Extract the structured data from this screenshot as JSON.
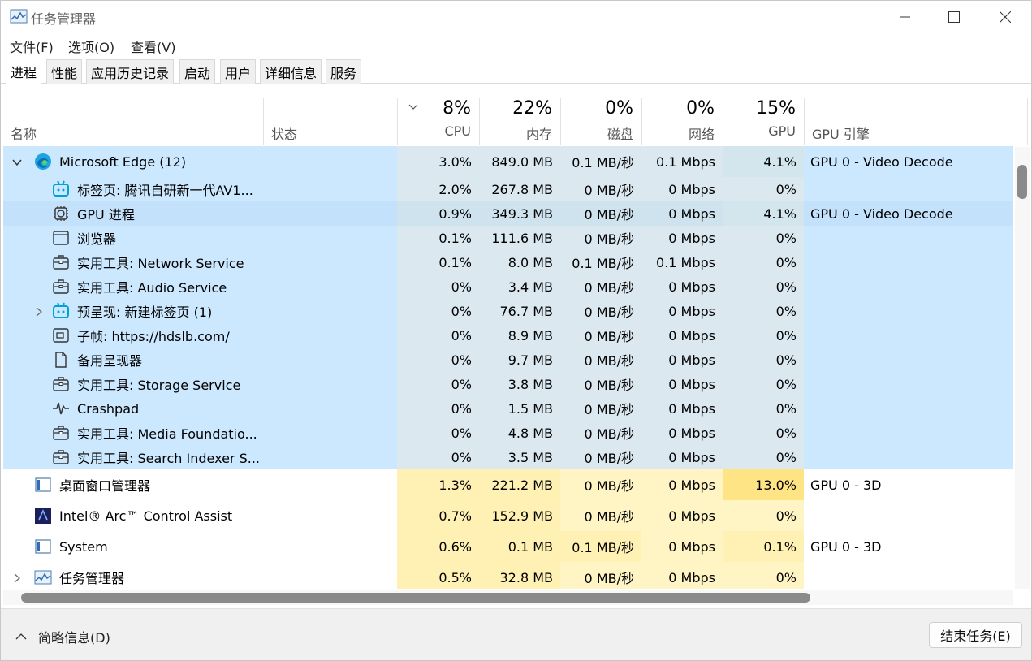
{
  "window": {
    "title": "任务管理器"
  },
  "menu": [
    "文件(F)",
    "选项(O)",
    "查看(V)"
  ],
  "tabs": [
    "进程",
    "性能",
    "应用历史记录",
    "启动",
    "用户",
    "详细信息",
    "服务"
  ],
  "columns": {
    "name": "名称",
    "status": "状态",
    "cpu": {
      "pct": "8%",
      "label": "CPU"
    },
    "mem": {
      "pct": "22%",
      "label": "内存"
    },
    "disk": {
      "pct": "0%",
      "label": "磁盘"
    },
    "net": {
      "pct": "0%",
      "label": "网络"
    },
    "gpu": {
      "pct": "15%",
      "label": "GPU"
    },
    "gpu_engine": "GPU 引擎"
  },
  "processes": [
    {
      "name": "Microsoft Edge (12)",
      "icon": "edge-icon",
      "cpu": "3.0%",
      "mem": "849.0 MB",
      "disk": "0.1 MB/秒",
      "net": "0.1 Mbps",
      "gpu": "4.1%",
      "engine": "GPU 0 - Video Decode"
    },
    {
      "name": "标签页: 腾讯自研新一代AV1...",
      "icon": "bilibili-icon",
      "cpu": "2.0%",
      "mem": "267.8 MB",
      "disk": "0 MB/秒",
      "net": "0 Mbps",
      "gpu": "0%",
      "engine": ""
    },
    {
      "name": "GPU 进程",
      "icon": "gpu-chip-icon",
      "cpu": "0.9%",
      "mem": "349.3 MB",
      "disk": "0 MB/秒",
      "net": "0 Mbps",
      "gpu": "4.1%",
      "engine": "GPU 0 - Video Decode"
    },
    {
      "name": "浏览器",
      "icon": "browser-window-icon",
      "cpu": "0.1%",
      "mem": "111.6 MB",
      "disk": "0 MB/秒",
      "net": "0 Mbps",
      "gpu": "0%",
      "engine": ""
    },
    {
      "name": "实用工具: Network Service",
      "icon": "toolbox-icon",
      "cpu": "0.1%",
      "mem": "8.0 MB",
      "disk": "0.1 MB/秒",
      "net": "0.1 Mbps",
      "gpu": "0%",
      "engine": ""
    },
    {
      "name": "实用工具: Audio Service",
      "icon": "toolbox-icon",
      "cpu": "0%",
      "mem": "3.4 MB",
      "disk": "0 MB/秒",
      "net": "0 Mbps",
      "gpu": "0%",
      "engine": ""
    },
    {
      "name": "预呈现: 新建标签页 (1)",
      "icon": "bilibili-icon",
      "cpu": "0%",
      "mem": "76.7 MB",
      "disk": "0 MB/秒",
      "net": "0 Mbps",
      "gpu": "0%",
      "engine": ""
    },
    {
      "name": "子帧: https://hdslb.com/",
      "icon": "subframe-icon",
      "cpu": "0%",
      "mem": "8.9 MB",
      "disk": "0 MB/秒",
      "net": "0 Mbps",
      "gpu": "0%",
      "engine": ""
    },
    {
      "name": "备用呈现器",
      "icon": "document-icon",
      "cpu": "0%",
      "mem": "9.7 MB",
      "disk": "0 MB/秒",
      "net": "0 Mbps",
      "gpu": "0%",
      "engine": ""
    },
    {
      "name": "实用工具: Storage Service",
      "icon": "toolbox-icon",
      "cpu": "0%",
      "mem": "3.8 MB",
      "disk": "0 MB/秒",
      "net": "0 Mbps",
      "gpu": "0%",
      "engine": ""
    },
    {
      "name": "Crashpad",
      "icon": "pulse-icon",
      "cpu": "0%",
      "mem": "1.5 MB",
      "disk": "0 MB/秒",
      "net": "0 Mbps",
      "gpu": "0%",
      "engine": ""
    },
    {
      "name": "实用工具: Media Foundatio...",
      "icon": "toolbox-icon",
      "cpu": "0%",
      "mem": "4.8 MB",
      "disk": "0 MB/秒",
      "net": "0 Mbps",
      "gpu": "0%",
      "engine": ""
    },
    {
      "name": "实用工具: Search Indexer S...",
      "icon": "toolbox-icon",
      "cpu": "0%",
      "mem": "3.5 MB",
      "disk": "0 MB/秒",
      "net": "0 Mbps",
      "gpu": "0%",
      "engine": ""
    },
    {
      "name": "桌面窗口管理器",
      "icon": "window-manager-icon",
      "cpu": "1.3%",
      "mem": "221.2 MB",
      "disk": "0 MB/秒",
      "net": "0 Mbps",
      "gpu": "13.0%",
      "engine": "GPU 0 - 3D"
    },
    {
      "name": "Intel® Arc™ Control Assist",
      "icon": "intel-arc-icon",
      "cpu": "0.7%",
      "mem": "152.9 MB",
      "disk": "0 MB/秒",
      "net": "0 Mbps",
      "gpu": "0%",
      "engine": ""
    },
    {
      "name": "System",
      "icon": "window-manager-icon",
      "cpu": "0.6%",
      "mem": "0.1 MB",
      "disk": "0.1 MB/秒",
      "net": "0 Mbps",
      "gpu": "0.1%",
      "engine": "GPU 0 - 3D"
    },
    {
      "name": "任务管理器",
      "icon": "task-manager-icon",
      "cpu": "0.5%",
      "mem": "32.8 MB",
      "disk": "0 MB/秒",
      "net": "0 Mbps",
      "gpu": "0%",
      "engine": ""
    }
  ],
  "footer": {
    "brief": "简略信息(D)",
    "end_task": "结束任务(E)"
  },
  "colors": {
    "selected": "#cce8ff",
    "selected_data": "#dbe8f0",
    "selected_data_hot": "#d4e6ed",
    "heat_low": "#fff4c4",
    "heat_mid": "#fff0b3",
    "heat_high": "#ffe485"
  }
}
